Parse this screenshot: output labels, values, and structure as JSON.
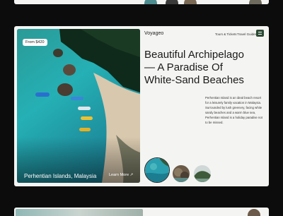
{
  "brand": {
    "name": "Voyageo"
  },
  "nav": {
    "tours": "Tours & Tickets",
    "guides": "Travel Guides"
  },
  "hero": {
    "price_badge": "From $420",
    "location": "Perhentian Islands, Malaysia",
    "cta": "Learn More ↗"
  },
  "headline": {
    "line1": "Beautiful Archipelago",
    "line2": "— A Paradise Of",
    "line3": "White-Sand Beaches"
  },
  "description": "Perhentian Island is an ideal beach resort for a leisurely family vacation in Malaysia. Surrounded by lush greenery, facing white sandy beaches and a warm blue sea, Perhentian Island is a holiday paradise not to be missed.",
  "thumbnails": [
    {
      "subject": "lagoon",
      "active": true
    },
    {
      "subject": "rocky-shore",
      "active": false
    },
    {
      "subject": "island-hill",
      "active": false
    }
  ],
  "colors": {
    "accent": "#2c4a34",
    "card_bg": "#f4f4f2",
    "page_bg": "#0c0c0c",
    "sea": "#1c9aa3"
  }
}
